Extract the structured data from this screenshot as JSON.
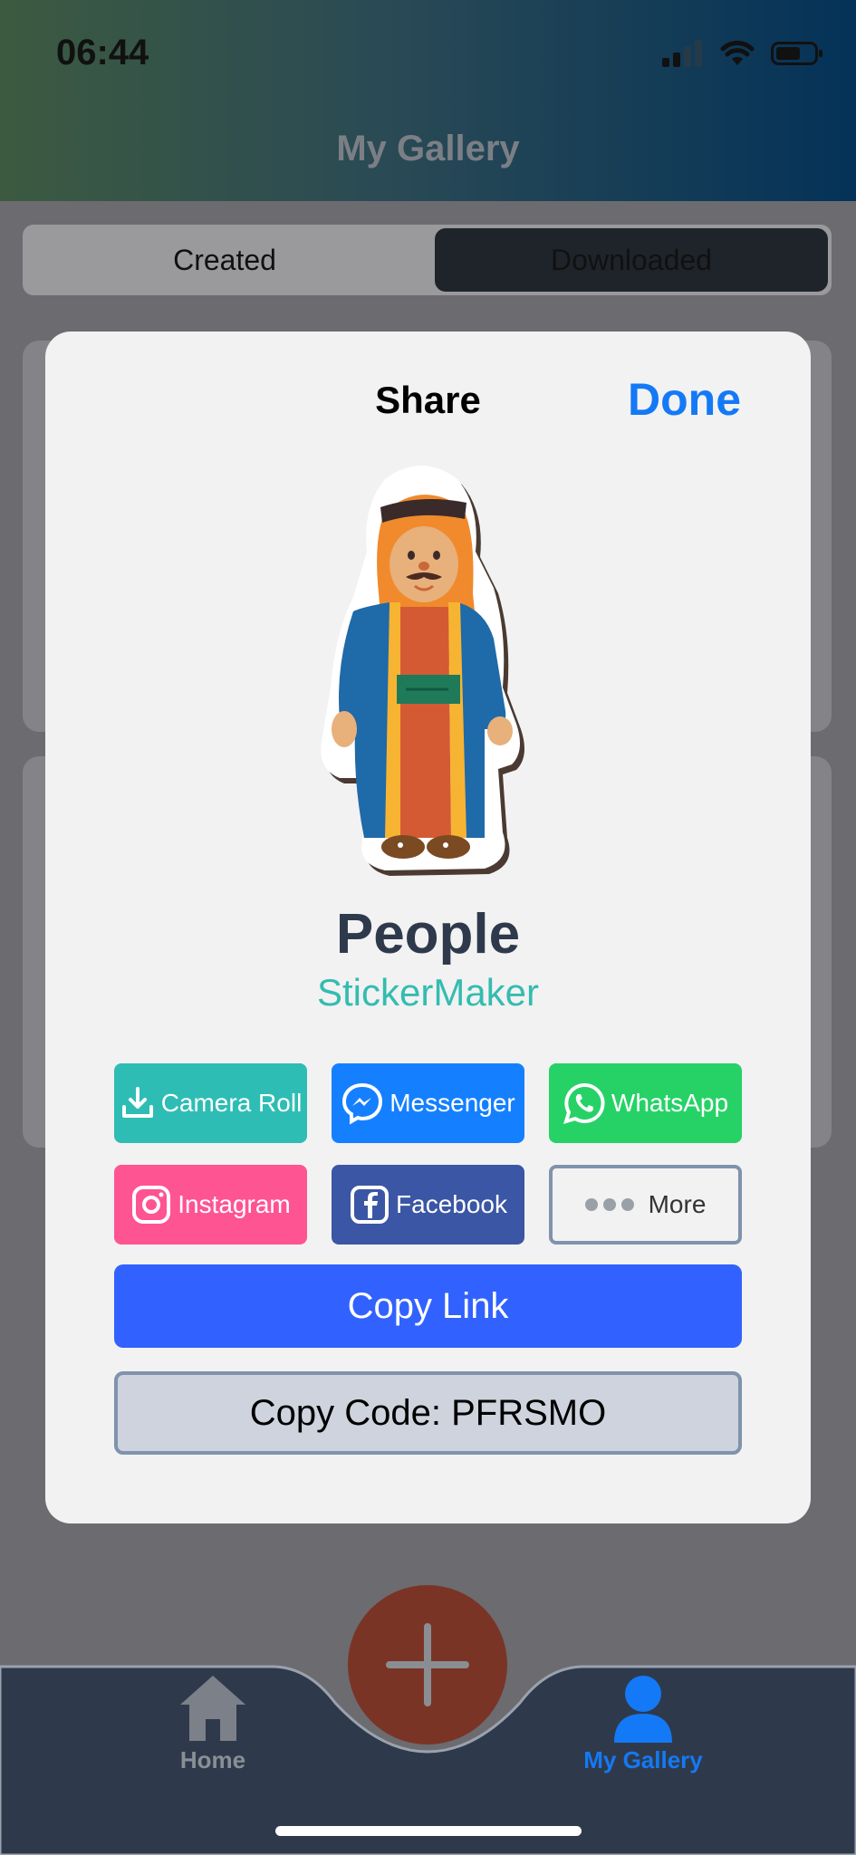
{
  "status_bar": {
    "time": "06:44",
    "icons": [
      "signal-icon",
      "wifi-icon",
      "battery-icon"
    ]
  },
  "header": {
    "title": "My Gallery"
  },
  "segmented": {
    "options": [
      "Created",
      "Downloaded"
    ],
    "selected": "Downloaded"
  },
  "modal": {
    "title": "Share",
    "done_label": "Done",
    "sticker": {
      "name": "People",
      "author": "StickerMaker",
      "image": "bedouin-character-sticker"
    },
    "share_buttons": [
      {
        "label": "Camera Roll",
        "icon": "download-icon",
        "color": "#2ebdb4"
      },
      {
        "label": "Messenger",
        "icon": "messenger-icon",
        "color": "#1580ff"
      },
      {
        "label": "WhatsApp",
        "icon": "whatsapp-icon",
        "color": "#26d266"
      },
      {
        "label": "Instagram",
        "icon": "instagram-icon",
        "color": "#ff5492"
      },
      {
        "label": "Facebook",
        "icon": "facebook-icon",
        "color": "#3b56a4"
      },
      {
        "label": "More",
        "icon": "more-dots-icon",
        "color": "#f2f2f2"
      }
    ],
    "copy_link_label": "Copy Link",
    "copy_code_label": "Copy Code: PFRSMO"
  },
  "tabbar": {
    "items": [
      {
        "label": "Home",
        "icon": "home-icon",
        "active": false
      },
      {
        "label": "My Gallery",
        "icon": "person-icon",
        "active": true
      }
    ],
    "add_button_icon": "plus-icon",
    "active_color": "#1479f6"
  }
}
